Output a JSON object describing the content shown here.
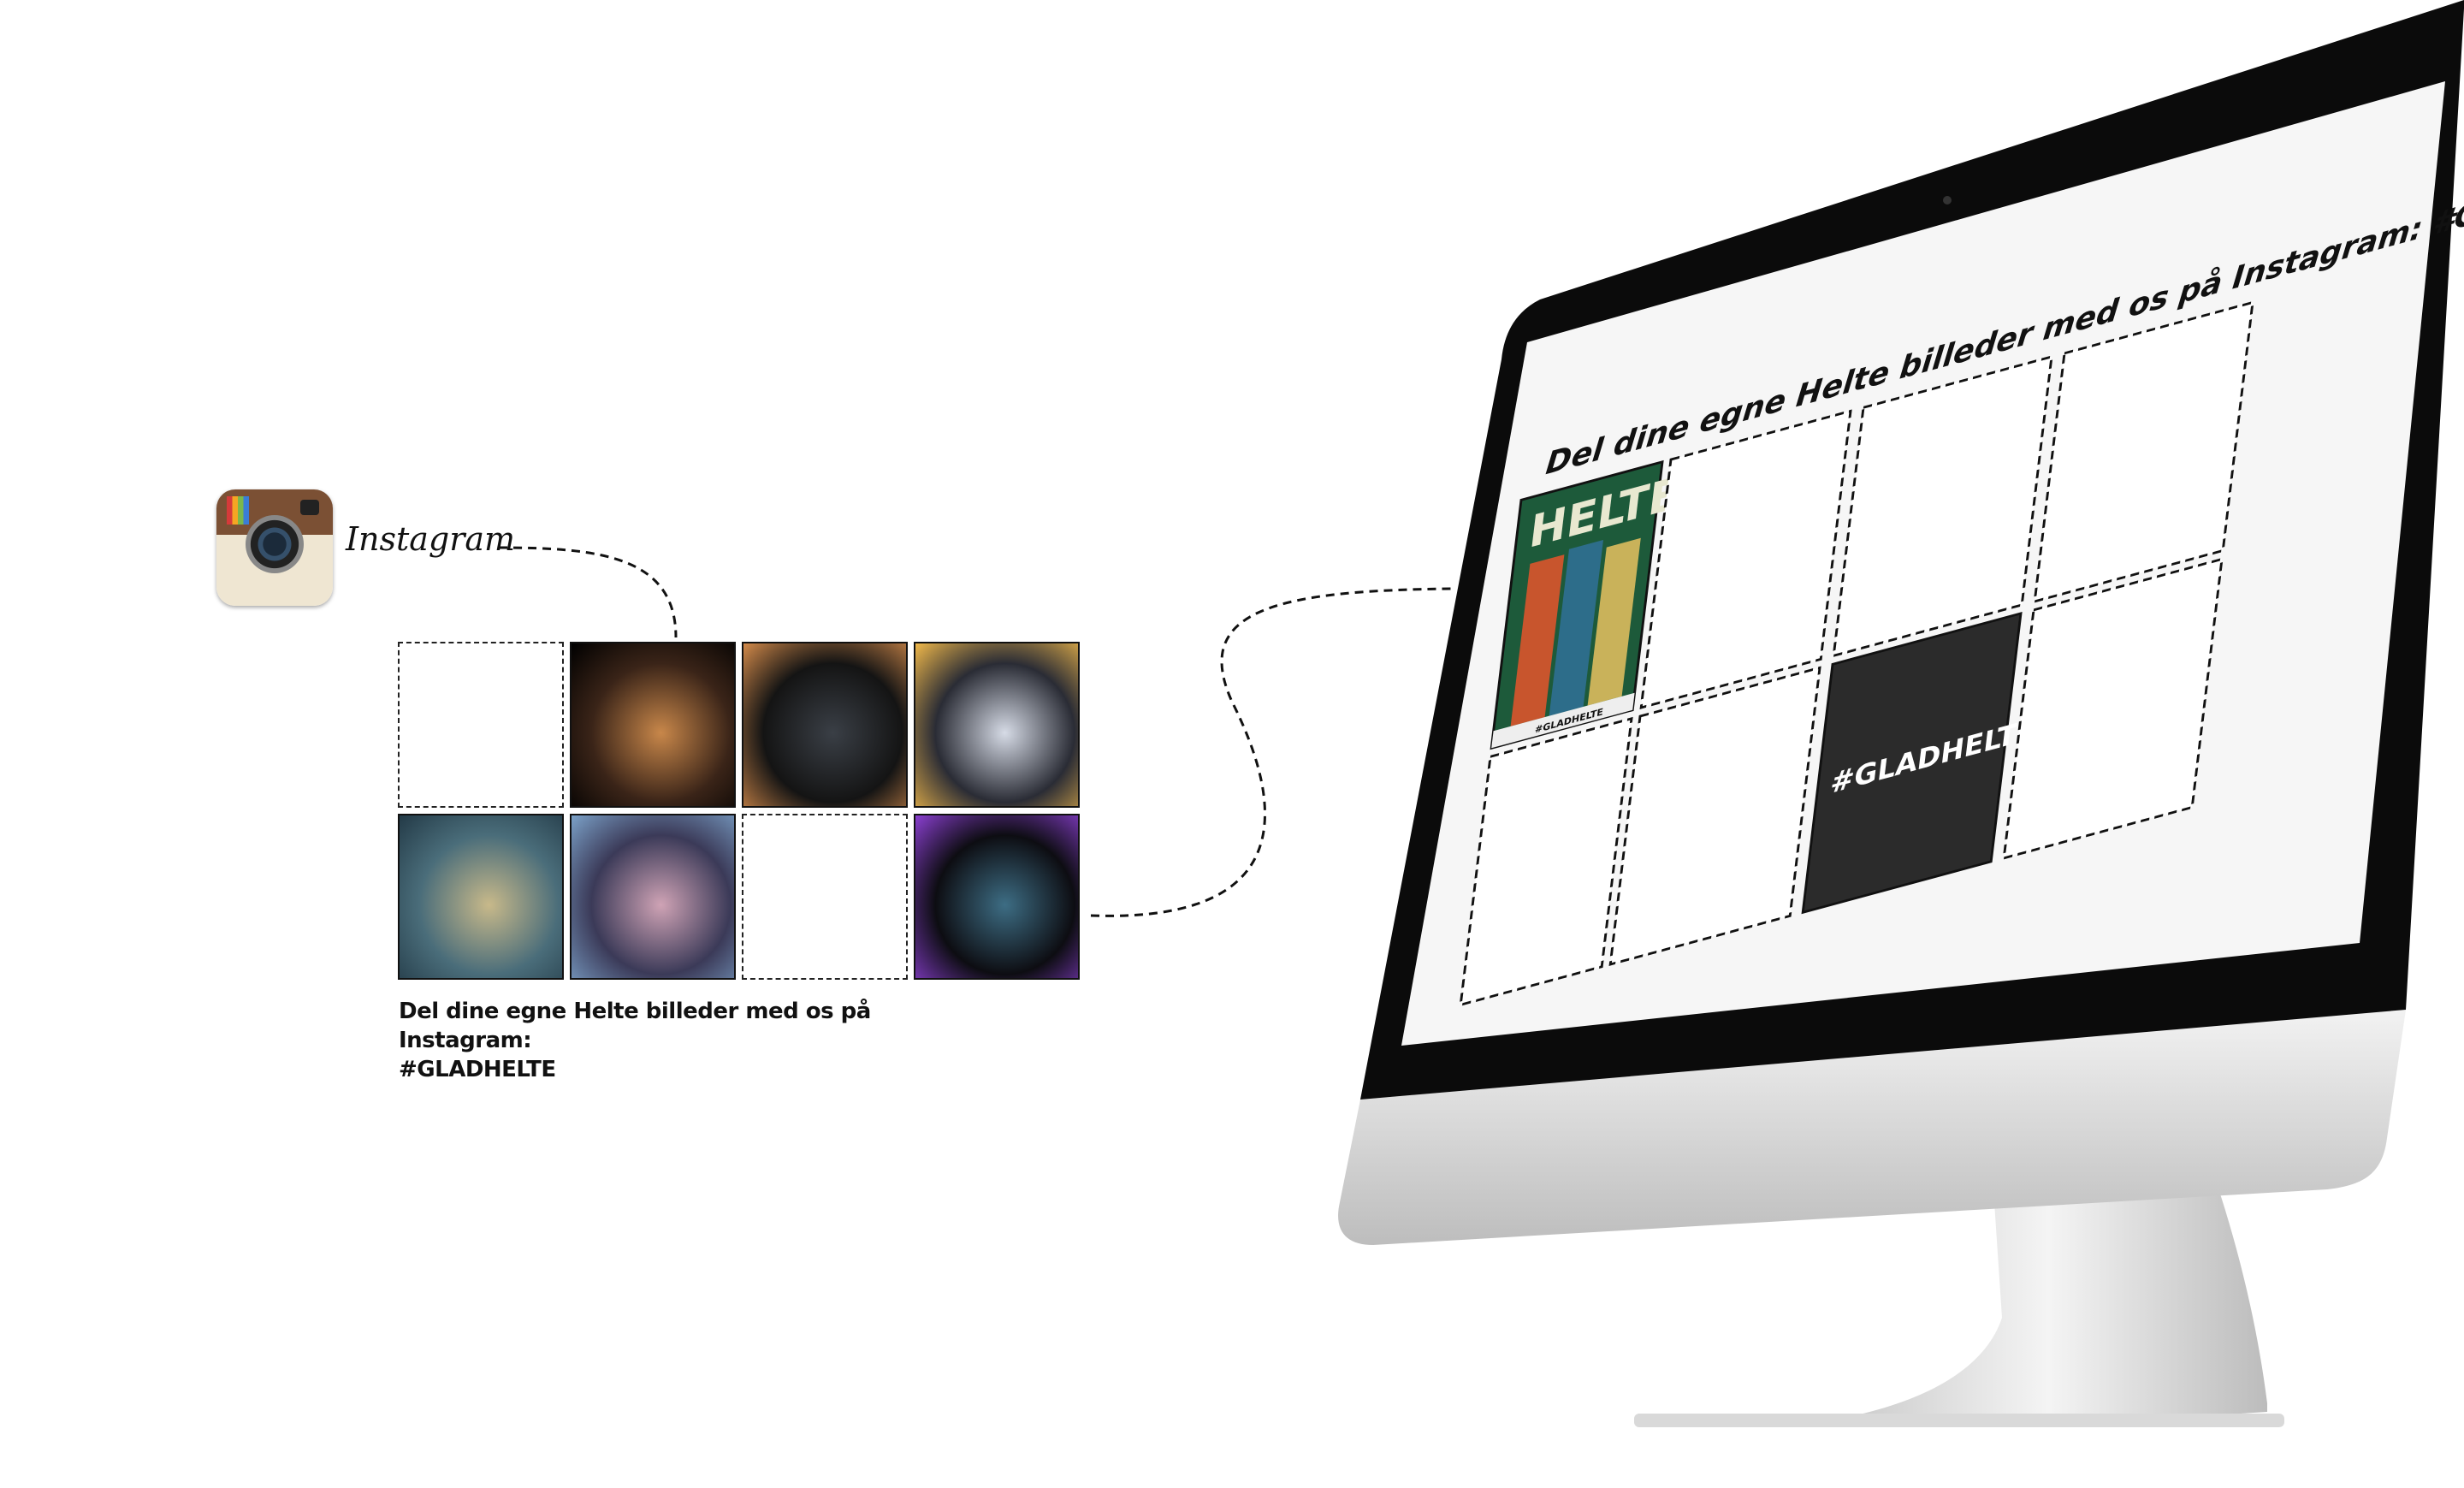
{
  "instagram": {
    "wordmark": "Instagram",
    "icon": "instagram-camera-icon"
  },
  "grid": {
    "tiles": [
      {
        "kind": "empty"
      },
      {
        "kind": "photo",
        "colors": [
          "#3a2418",
          "#c8874a",
          "#000000"
        ]
      },
      {
        "kind": "photo",
        "colors": [
          "#141414",
          "#3a3f46",
          "#d38a4a"
        ]
      },
      {
        "kind": "photo",
        "colors": [
          "#2a2c35",
          "#d6dbe6",
          "#f0b84a"
        ]
      },
      {
        "kind": "photo",
        "colors": [
          "#4a6d7a",
          "#c8b98a",
          "#233a47"
        ]
      },
      {
        "kind": "photo",
        "colors": [
          "#3b3a58",
          "#cfa3b5",
          "#7ba1c8"
        ]
      },
      {
        "kind": "empty"
      },
      {
        "kind": "photo",
        "colors": [
          "#0d0d12",
          "#3d6d84",
          "#8a3fd0"
        ]
      }
    ],
    "caption_line1": "Del dine egne Helte billeder med os på Instagram:",
    "caption_line2": "#GLADHELTE"
  },
  "monitor": {
    "heading": "Del dine egne Helte billeder med os på Instagram: #GLADHELTE",
    "poster_title": "HELTE",
    "hashtag_tile": "#GLADHELTE",
    "poster_footer": "#GLADHELTE"
  }
}
